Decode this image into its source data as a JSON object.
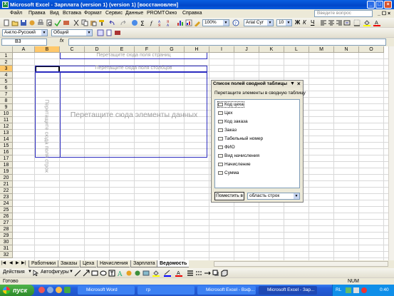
{
  "window": {
    "title": "Microsoft Excel - Зарплата (version 1) (version 1)  [восстановлен]",
    "app_icon": "excel-icon"
  },
  "menu": {
    "items": [
      "Файл",
      "Правка",
      "Вид",
      "Вставка",
      "Формат",
      "Сервис",
      "Данные",
      "PROMT",
      "Окно",
      "Справка"
    ],
    "help_placeholder": "Введите вопрос"
  },
  "toolbar": {
    "zoom": "100%",
    "font_name": "Arial Cyr",
    "font_size": "10",
    "dictionary": "Англо-Русский",
    "template": "Общий"
  },
  "formula_bar": {
    "cell_ref": "B3",
    "fx": "fx",
    "value": ""
  },
  "grid": {
    "columns": [
      "A",
      "B",
      "C",
      "D",
      "E",
      "F",
      "G",
      "H",
      "I",
      "J",
      "K",
      "L",
      "M",
      "N",
      "O"
    ],
    "rows": [
      "1",
      "2",
      "3",
      "4",
      "5",
      "6",
      "7",
      "8",
      "9",
      "10",
      "11",
      "12",
      "13",
      "14",
      "15",
      "16",
      "17",
      "18",
      "19",
      "20",
      "21",
      "22",
      "23",
      "24",
      "25",
      "26",
      "27",
      "28",
      "29",
      "30",
      "31",
      "32"
    ],
    "selected_column": "B",
    "selected_row": "3"
  },
  "pivot": {
    "page_drop": "Перетащите сюда поля страниц",
    "column_drop": "Перетащите сюда поля столбцов",
    "row_drop": "Перетащите сюда поля строк",
    "data_drop": "Перетащите сюда элементы данных"
  },
  "field_list": {
    "title": "Список полей сводной таблицы",
    "instruction": "Перетащите элементы в сводную таблицу",
    "fields": [
      "Код цеха",
      "Цех",
      "Код заказа",
      "Заказ",
      "Табельный номер",
      "ФИО",
      "Вид начисления",
      "Начисление",
      "Сумма"
    ],
    "add_button": "Поместить в",
    "area_select": "область строк"
  },
  "sheet_tabs": {
    "tabs": [
      "Работники",
      "Заказы",
      "Цеха",
      "Начисления",
      "Зарплата",
      "Ведомость"
    ],
    "active": "Ведомость"
  },
  "draw_toolbar": {
    "actions": "Действия",
    "autoshapes": "Автофигуры"
  },
  "status": {
    "left": "Готово",
    "num": "NUM"
  },
  "taskbar": {
    "start": "пуск",
    "tasks": [
      "Microsoft Word",
      "гр",
      "Microsoft Excel - Вэф...",
      "Microsoft Excel - Зар..."
    ],
    "lang": "RL",
    "time": "0:40"
  }
}
